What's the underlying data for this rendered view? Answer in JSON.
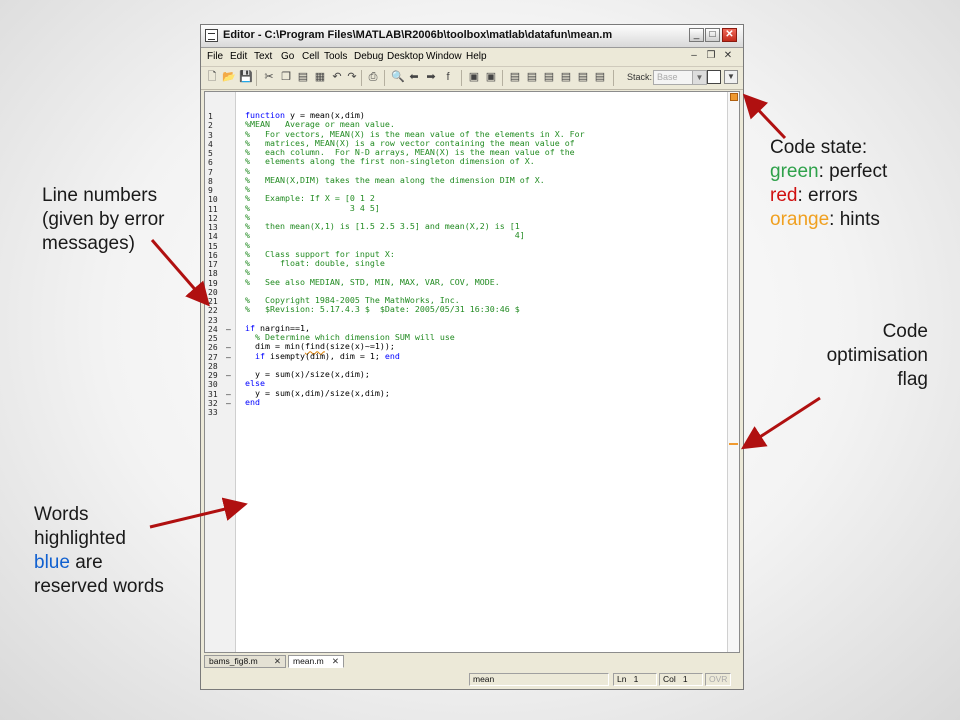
{
  "window": {
    "title": "Editor - C:\\Program Files\\MATLAB\\R2006b\\toolbox\\matlab\\datafun\\mean.m",
    "controls": {
      "minimize": "_",
      "maximize": "□",
      "close": "✕"
    }
  },
  "menu": {
    "items": [
      "File",
      "Edit",
      "Text",
      "Go",
      "Cell",
      "Tools",
      "Debug",
      "Desktop",
      "Window",
      "Help"
    ]
  },
  "toolbar": {
    "stack_label": "Stack:",
    "stack_value": "Base"
  },
  "code": {
    "lines": [
      {
        "n": "1",
        "dash": "",
        "parts": [
          [
            "kw",
            "function"
          ],
          [
            "tx",
            " y = mean(x,dim)"
          ]
        ]
      },
      {
        "n": "2",
        "dash": "",
        "parts": [
          [
            "cm",
            "%MEAN   Average or mean value."
          ]
        ]
      },
      {
        "n": "3",
        "dash": "",
        "parts": [
          [
            "cm",
            "%   For vectors, MEAN(X) is the mean value of the elements in X. For"
          ]
        ]
      },
      {
        "n": "4",
        "dash": "",
        "parts": [
          [
            "cm",
            "%   matrices, MEAN(X) is a row vector containing the mean value of"
          ]
        ]
      },
      {
        "n": "5",
        "dash": "",
        "parts": [
          [
            "cm",
            "%   each column.  For N-D arrays, MEAN(X) is the mean value of the"
          ]
        ]
      },
      {
        "n": "6",
        "dash": "",
        "parts": [
          [
            "cm",
            "%   elements along the first non-singleton dimension of X."
          ]
        ]
      },
      {
        "n": "7",
        "dash": "",
        "parts": [
          [
            "cm",
            "%"
          ]
        ]
      },
      {
        "n": "8",
        "dash": "",
        "parts": [
          [
            "cm",
            "%   MEAN(X,DIM) takes the mean along the dimension DIM of X."
          ]
        ]
      },
      {
        "n": "9",
        "dash": "",
        "parts": [
          [
            "cm",
            "%"
          ]
        ]
      },
      {
        "n": "10",
        "dash": "",
        "parts": [
          [
            "cm",
            "%   Example: If X = [0 1 2"
          ]
        ]
      },
      {
        "n": "11",
        "dash": "",
        "parts": [
          [
            "cm",
            "%                    3 4 5]"
          ]
        ]
      },
      {
        "n": "12",
        "dash": "",
        "parts": [
          [
            "cm",
            "%"
          ]
        ]
      },
      {
        "n": "13",
        "dash": "",
        "parts": [
          [
            "cm",
            "%   then mean(X,1) is [1.5 2.5 3.5] and mean(X,2) is [1"
          ]
        ]
      },
      {
        "n": "14",
        "dash": "",
        "parts": [
          [
            "cm",
            "%                                                     4]"
          ]
        ]
      },
      {
        "n": "15",
        "dash": "",
        "parts": [
          [
            "cm",
            "%"
          ]
        ]
      },
      {
        "n": "16",
        "dash": "",
        "parts": [
          [
            "cm",
            "%   Class support for input X:"
          ]
        ]
      },
      {
        "n": "17",
        "dash": "",
        "parts": [
          [
            "cm",
            "%      float: double, single"
          ]
        ]
      },
      {
        "n": "18",
        "dash": "",
        "parts": [
          [
            "cm",
            "%"
          ]
        ]
      },
      {
        "n": "19",
        "dash": "",
        "parts": [
          [
            "cm",
            "%   See also MEDIAN, STD, MIN, MAX, VAR, COV, MODE."
          ]
        ]
      },
      {
        "n": "20",
        "dash": "",
        "parts": []
      },
      {
        "n": "21",
        "dash": "",
        "parts": [
          [
            "cm",
            "%   Copyright 1984-2005 The MathWorks, Inc."
          ]
        ]
      },
      {
        "n": "22",
        "dash": "",
        "parts": [
          [
            "cm",
            "%   $Revision: 5.17.4.3 $  $Date: 2005/05/31 16:30:46 $"
          ]
        ]
      },
      {
        "n": "23",
        "dash": "",
        "parts": []
      },
      {
        "n": "24",
        "dash": "–",
        "parts": [
          [
            "kw",
            "if"
          ],
          [
            "tx",
            " nargin==1,"
          ]
        ]
      },
      {
        "n": "25",
        "dash": "",
        "parts": [
          [
            "tx",
            "  "
          ],
          [
            "cm",
            "% Determine which dimension SUM will use"
          ]
        ]
      },
      {
        "n": "26",
        "dash": "–",
        "parts": [
          [
            "tx",
            "  dim = min("
          ],
          [
            "sq",
            "find"
          ],
          [
            "tx",
            "(size(x)~=1));"
          ]
        ]
      },
      {
        "n": "27",
        "dash": "–",
        "parts": [
          [
            "tx",
            "  "
          ],
          [
            "kw",
            "if"
          ],
          [
            "tx",
            " isempty(dim), dim = 1; "
          ],
          [
            "kw",
            "end"
          ]
        ]
      },
      {
        "n": "28",
        "dash": "",
        "parts": []
      },
      {
        "n": "29",
        "dash": "–",
        "parts": [
          [
            "tx",
            "  y = sum(x)/size(x,dim);"
          ]
        ]
      },
      {
        "n": "30",
        "dash": "",
        "parts": [
          [
            "kw",
            "else"
          ]
        ]
      },
      {
        "n": "31",
        "dash": "–",
        "parts": [
          [
            "tx",
            "  y = sum(x,dim)/size(x,dim);"
          ]
        ]
      },
      {
        "n": "32",
        "dash": "–",
        "parts": [
          [
            "kw",
            "end"
          ]
        ]
      },
      {
        "n": "33",
        "dash": "",
        "parts": []
      }
    ]
  },
  "tabs": [
    {
      "label": "bams_fig8.m",
      "close": "✕"
    },
    {
      "label": "mean.m",
      "close": "✕"
    }
  ],
  "status": {
    "function": "mean",
    "ln_label": "Ln",
    "ln_value": "1",
    "col_label": "Col",
    "col_value": "1",
    "mode": "OVR"
  },
  "annotations": {
    "code_state": {
      "title": "Code state:",
      "green_word": "green",
      "green_rest": ": perfect",
      "red_word": "red",
      "red_rest": ": errors",
      "orange_word": "orange",
      "orange_rest": ": hints"
    },
    "line_numbers": [
      "Line numbers",
      "(given by error",
      "messages)"
    ],
    "optimisation": [
      "Code",
      "optimisation",
      "flag"
    ],
    "reserved": {
      "l1": "Words",
      "l2": "highlighted",
      "blue_word": "blue",
      "l3_rest": " are",
      "l4": "reserved words"
    }
  },
  "colors": {
    "keyword": "#0000ff",
    "comment": "#228b22",
    "annot_green": "#2ea14a",
    "annot_red": "#d01010",
    "annot_orange": "#f0a020",
    "annot_blue": "#1060d0",
    "arrow": "#b01010"
  }
}
